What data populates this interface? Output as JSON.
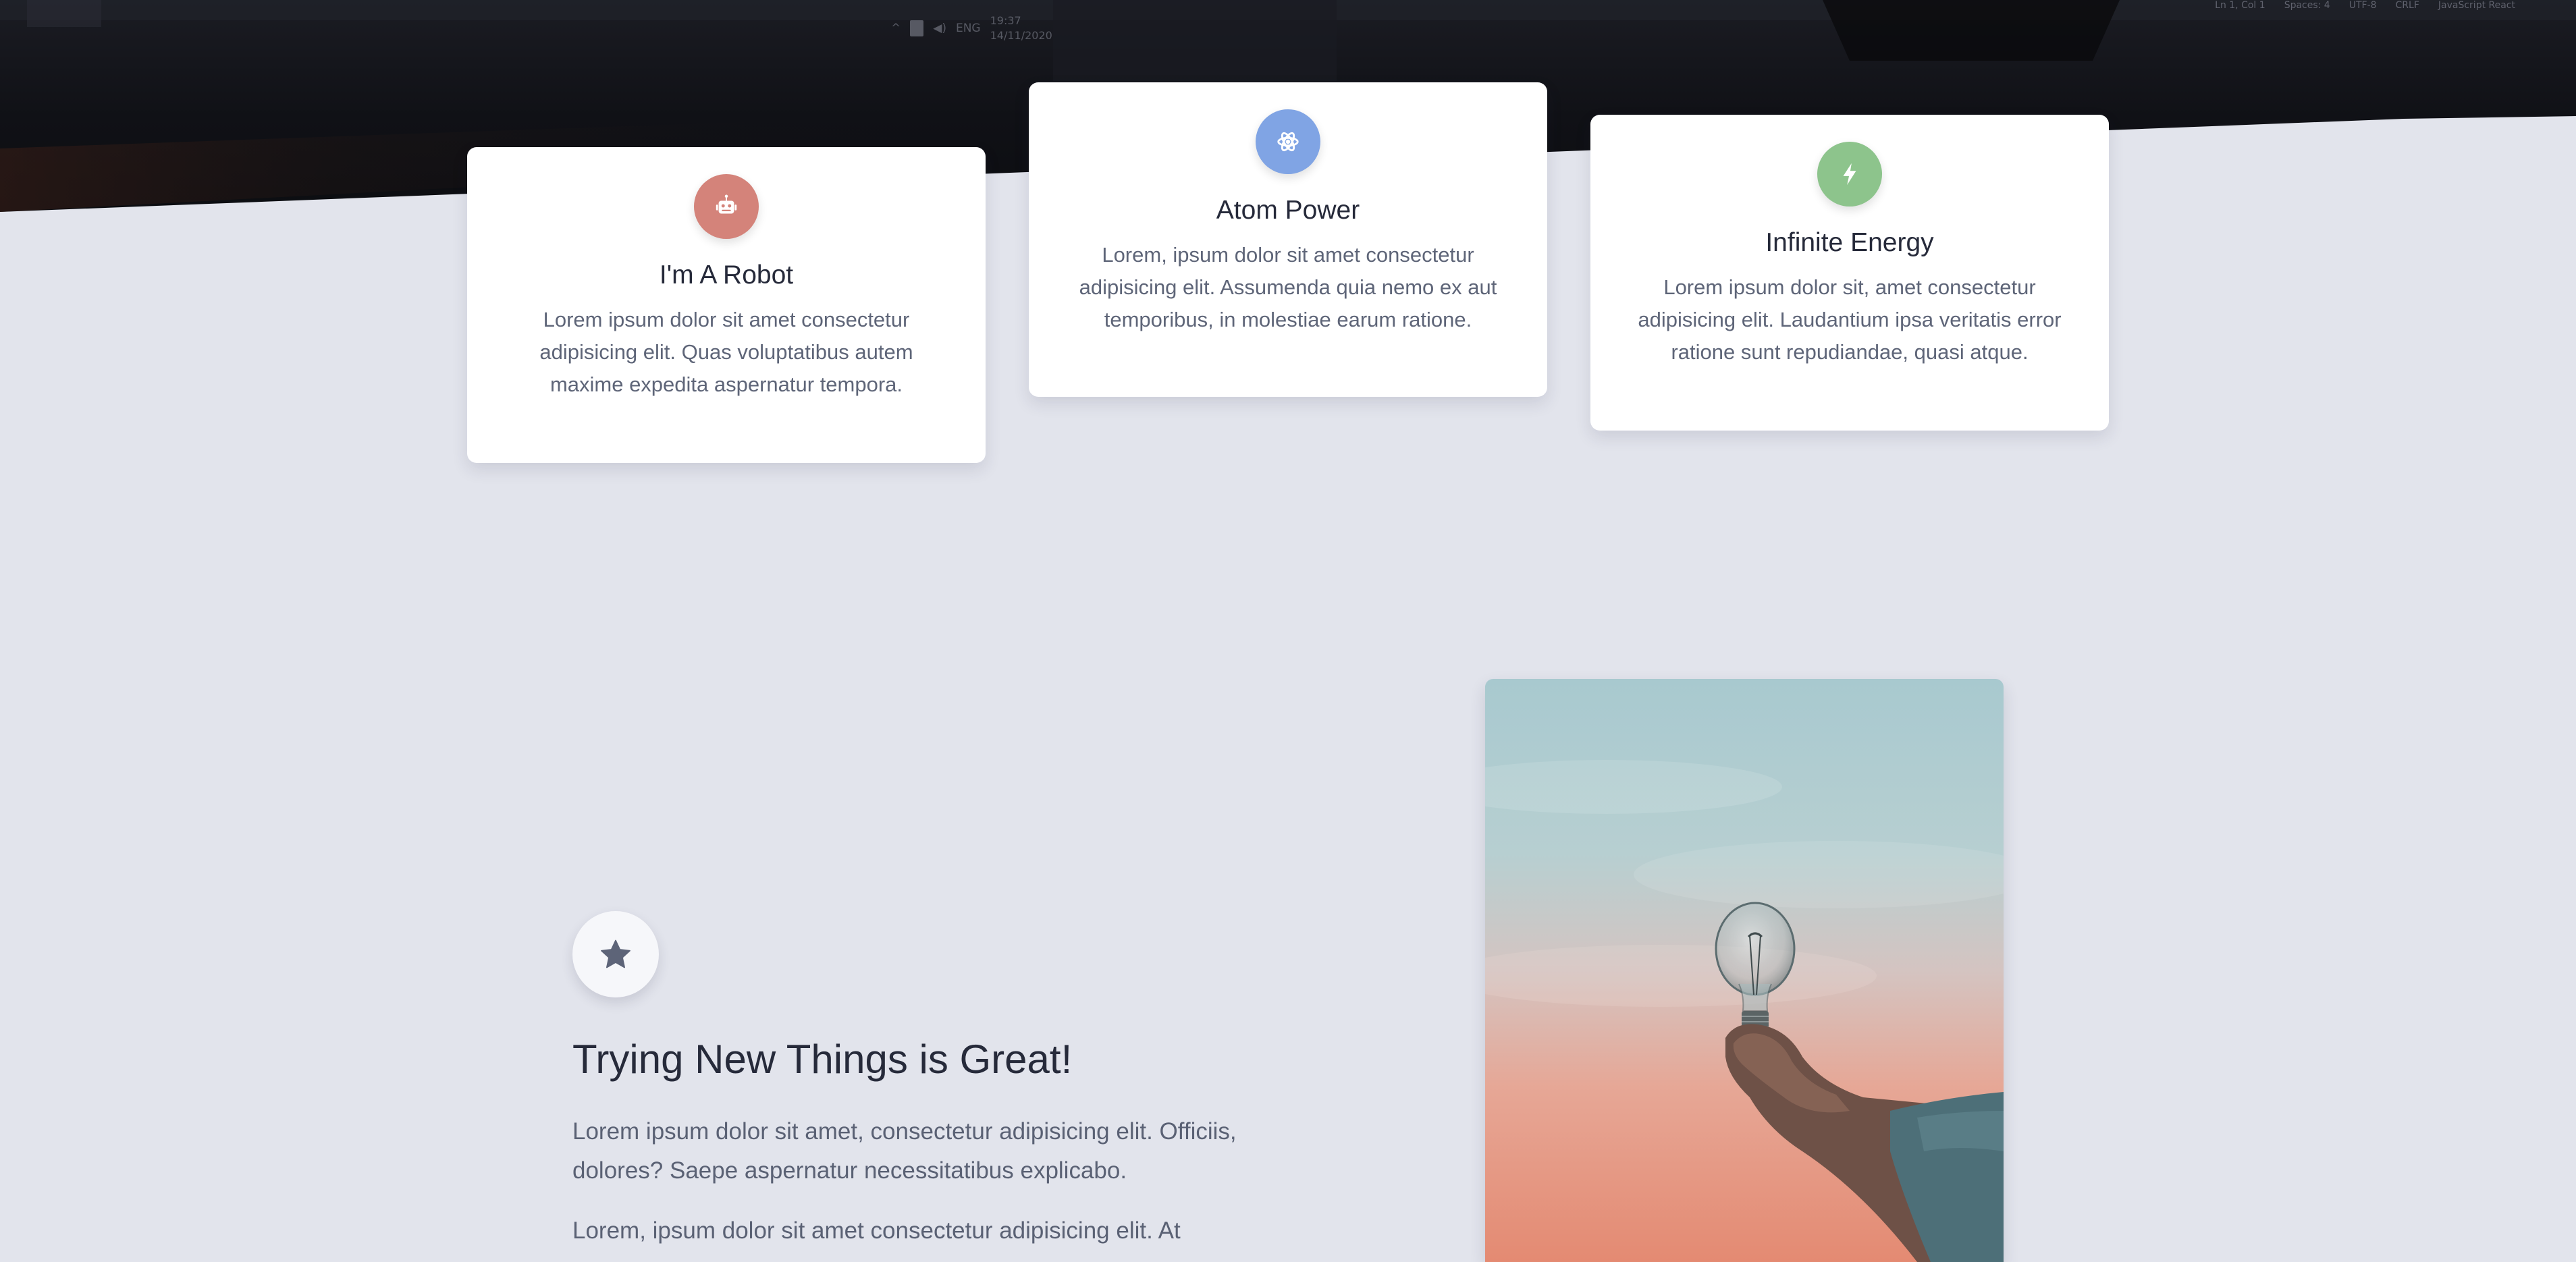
{
  "hero": {
    "tray_lang": "ENG",
    "tray_time": "19:37",
    "tray_date": "14/11/2020",
    "status_items": [
      "Ln 1, Col 1",
      "Spaces: 4",
      "UTF-8",
      "CRLF",
      "JavaScript React"
    ]
  },
  "features": [
    {
      "title": "I'm A Robot",
      "text": "Lorem ipsum dolor sit amet consectetur adipisicing elit. Quas voluptatibus autem maxime expedita aspernatur tempora.",
      "icon": "robot-icon",
      "color": "#d4837a"
    },
    {
      "title": "Atom Power",
      "text": "Lorem, ipsum dolor sit amet consectetur adipisicing elit. Assumenda quia nemo ex aut temporibus, in molestiae earum ratione.",
      "icon": "atom-icon",
      "color": "#80a4e4"
    },
    {
      "title": "Infinite Energy",
      "text": "Lorem ipsum dolor sit, amet consectetur adipisicing elit. Laudantium ipsa veritatis error ratione sunt repudiandae, quasi atque.",
      "icon": "bolt-icon",
      "color": "#8dc48c"
    }
  ],
  "section": {
    "icon": "star-icon",
    "title": "Trying New Things is Great!",
    "paragraph_1": "Lorem ipsum dolor sit amet, consectetur adipisicing elit. Officiis, dolores? Saepe aspernatur necessitatibus explicabo.",
    "paragraph_2": "Lorem, ipsum dolor sit amet consectetur adipisicing elit. At"
  },
  "photo": {
    "subject": "hand-holding-lightbulb-image"
  },
  "colors": {
    "background": "#e2e4ec",
    "hero_dark": "#14151b",
    "card": "#ffffff",
    "heading": "#262a3a",
    "body_text": "#5e6578"
  }
}
